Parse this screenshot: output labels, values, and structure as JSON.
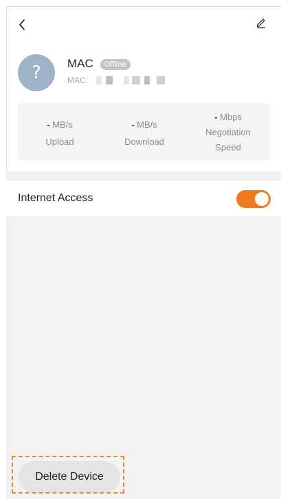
{
  "device": {
    "name": "MAC",
    "status_badge": "Offline",
    "mac_label": "MAC:",
    "avatar_glyph": "?"
  },
  "stats": {
    "upload": {
      "value": "-",
      "unit": "MB/s",
      "label": "Upload"
    },
    "download": {
      "value": "-",
      "unit": "MB/s",
      "label": "Download"
    },
    "negotiation": {
      "value": "-",
      "unit": "Mbps",
      "label_line1": "Negotiation",
      "label_line2": "Speed"
    }
  },
  "internet_access": {
    "label": "Internet Access",
    "enabled": true
  },
  "actions": {
    "delete_label": "Delete Device"
  },
  "colors": {
    "accent": "#f07a1e",
    "avatar": "#9fb2c8",
    "badge": "#c4c4c4",
    "highlight_dash": "#e8862a"
  },
  "icons": {
    "back": "chevron-left-icon",
    "edit": "pencil-icon"
  }
}
